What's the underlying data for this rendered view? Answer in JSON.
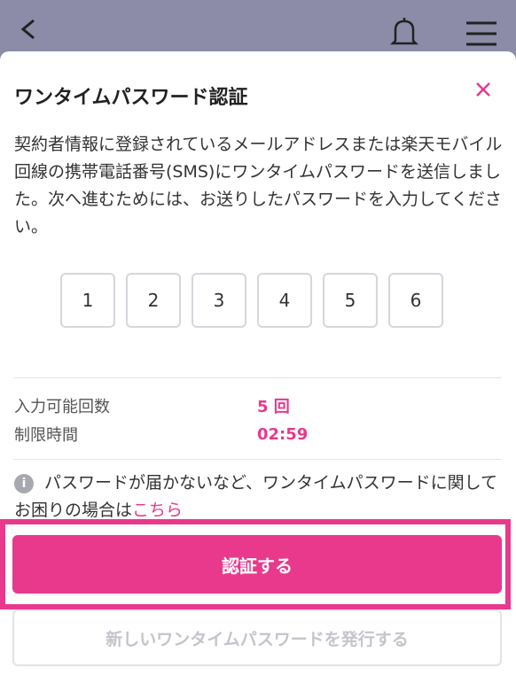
{
  "header": {
    "icons": {
      "back": "chevron-left-icon",
      "notifications": "bell-icon",
      "menu": "hamburger-menu-icon"
    }
  },
  "modal": {
    "title": "ワンタイムパスワード認証",
    "close_icon": "close-icon",
    "description": "契約者情報に登録されているメールアドレスまたは楽天モバイル回線の携帯電話番号(SMS)にワンタイムパスワードを送信しました。次へ進むためには、お送りしたパスワードを入力してください。",
    "otp_digits": [
      "1",
      "2",
      "3",
      "4",
      "5",
      "6"
    ],
    "info": {
      "attempts_label": "入力可能回数",
      "attempts_value": "5 回",
      "time_label": "制限時間",
      "time_value": "02:59"
    },
    "help": {
      "icon": "info-icon",
      "text": "パスワードが届かないなど、ワンタイムパスワードに関してお困りの場合は",
      "link_text": "こちら"
    },
    "primary_button": "認証する",
    "secondary_button": "新しいワンタイムパスワードを発行する"
  },
  "colors": {
    "accent": "#e8398d",
    "overlay": "#8c8ca8",
    "disabled_text": "#c4c4cc"
  }
}
